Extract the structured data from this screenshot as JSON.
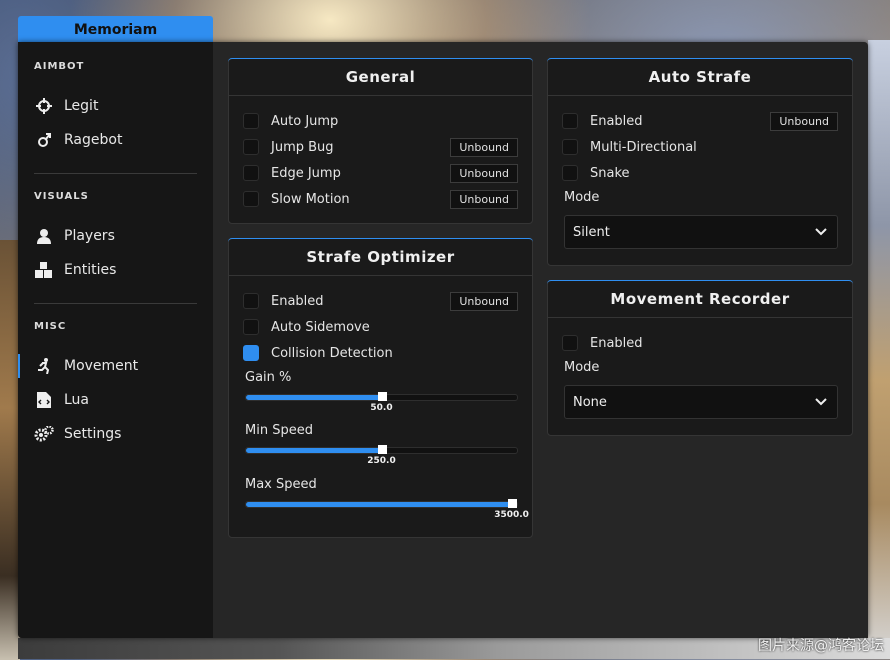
{
  "app": {
    "tab_title": "Memoriam"
  },
  "sidebar": {
    "sections": [
      {
        "title": "AIMBOT",
        "items": [
          {
            "label": "Legit",
            "icon": "crosshair-icon"
          },
          {
            "label": "Ragebot",
            "icon": "gender-icon"
          }
        ]
      },
      {
        "title": "VISUALS",
        "items": [
          {
            "label": "Players",
            "icon": "user-icon"
          },
          {
            "label": "Entities",
            "icon": "boxes-icon"
          }
        ]
      },
      {
        "title": "MISC",
        "items": [
          {
            "label": "Movement",
            "icon": "running-icon",
            "active": true
          },
          {
            "label": "Lua",
            "icon": "file-code-icon"
          },
          {
            "label": "Settings",
            "icon": "gears-icon"
          }
        ]
      }
    ]
  },
  "general": {
    "title": "General",
    "rows": [
      {
        "label": "Auto Jump",
        "checked": false,
        "bind": ""
      },
      {
        "label": "Jump Bug",
        "checked": false,
        "bind": "Unbound"
      },
      {
        "label": "Edge Jump",
        "checked": false,
        "bind": "Unbound"
      },
      {
        "label": "Slow Motion",
        "checked": false,
        "bind": "Unbound"
      }
    ]
  },
  "strafe_optimizer": {
    "title": "Strafe Optimizer",
    "rows": [
      {
        "label": "Enabled",
        "checked": false,
        "bind": "Unbound"
      },
      {
        "label": "Auto Sidemove",
        "checked": false,
        "bind": ""
      },
      {
        "label": "Collision Detection",
        "checked": true,
        "bind": ""
      }
    ],
    "sliders": [
      {
        "label": "Gain %",
        "value": "50.0",
        "fraction": 0.5
      },
      {
        "label": "Min Speed",
        "value": "250.0",
        "fraction": 0.5
      },
      {
        "label": "Max Speed",
        "value": "3500.0",
        "fraction": 0.98
      }
    ]
  },
  "auto_strafe": {
    "title": "Auto Strafe",
    "rows": [
      {
        "label": "Enabled",
        "checked": false,
        "bind": "Unbound"
      },
      {
        "label": "Multi-Directional",
        "checked": false,
        "bind": ""
      },
      {
        "label": "Snake",
        "checked": false,
        "bind": ""
      }
    ],
    "mode_label": "Mode",
    "mode_value": "Silent"
  },
  "movement_recorder": {
    "title": "Movement Recorder",
    "rows": [
      {
        "label": "Enabled",
        "checked": false,
        "bind": ""
      }
    ],
    "mode_label": "Mode",
    "mode_value": "None"
  },
  "watermark": "图片来源@鸿客论坛",
  "colors": {
    "accent": "#2f8ef0",
    "panel": "#1a1a1a",
    "window": "#262626",
    "sidebar": "#161616"
  }
}
